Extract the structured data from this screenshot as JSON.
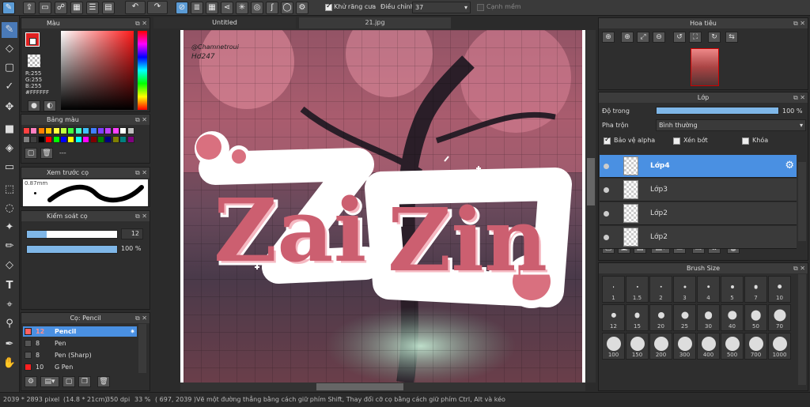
{
  "toolbar": {
    "antialias_label": "Khử răng cưa",
    "adjust_label": "Điều chỉnh",
    "adjust_value": "37",
    "edge_label": "Cạnh mềm"
  },
  "tabs": [
    {
      "label": "Untitled"
    },
    {
      "label": "21.jpg"
    }
  ],
  "color_panel": {
    "title": "Màu",
    "r": "R:255",
    "g": "G:255",
    "b": "B:255",
    "hex": "#FFFFFF",
    "primary": "#e02020",
    "secondary": "#ffffff"
  },
  "palette_panel": {
    "title": "Bảng màu",
    "name": "---",
    "swatches": [
      "#ff4040",
      "#ff80c0",
      "#ff8000",
      "#ffc000",
      "#ffff40",
      "#c0ff40",
      "#40ff40",
      "#40ffc0",
      "#40c0ff",
      "#4080ff",
      "#8040ff",
      "#c040ff",
      "#ff40ff",
      "#ffffff",
      "#c0c0c0",
      "#808080",
      "#404040",
      "#000000",
      "#ff0000",
      "#00ff00",
      "#0000ff",
      "#ffff00",
      "#00ffff",
      "#ff00ff",
      "#800000",
      "#008000",
      "#000080",
      "#808000",
      "#008080",
      "#800080"
    ]
  },
  "preview_panel": {
    "title": "Xem trước cọ",
    "size_label": "0.87mm"
  },
  "brush_control": {
    "title": "Kiểm soát cọ",
    "size_value": "12",
    "opacity_value": "100 %",
    "size_fraction": 0.22,
    "opacity_fraction": 1.0
  },
  "brush_list": {
    "title": "Cọ: Pencil",
    "items": [
      {
        "size": "12",
        "name": "Pencil",
        "color": "#ff6060"
      },
      {
        "size": "8",
        "name": "Pen",
        "color": "#555555"
      },
      {
        "size": "8",
        "name": "Pen (Sharp)",
        "color": "#555555"
      },
      {
        "size": "10",
        "name": "G Pen",
        "color": "#ff2020"
      }
    ]
  },
  "artwork": {
    "watermark_1": "@Chamnetroui",
    "watermark_2": "Hd247",
    "word_1": "Zai",
    "word_2": "Zin"
  },
  "navigator": {
    "title": "Hoa tiêu"
  },
  "layer_panel": {
    "title": "Lớp",
    "opacity_label": "Độ trong",
    "opacity_value": "100 %",
    "opacity_fraction": 1.0,
    "blend_label": "Pha trộn",
    "blend_value": "Bình thường",
    "protect_alpha": "Bảo vệ alpha",
    "clipping": "Xén bớt",
    "lock": "Khóa",
    "layers": [
      {
        "name": "Lớp4"
      },
      {
        "name": "Lớp3"
      },
      {
        "name": "Lớp2"
      },
      {
        "name": "Lớp2"
      }
    ]
  },
  "brush_size": {
    "title": "Brush Size",
    "sizes": [
      "1",
      "1.5",
      "2",
      "3",
      "4",
      "5",
      "7",
      "10",
      "12",
      "15",
      "20",
      "25",
      "30",
      "40",
      "50",
      "70",
      "100",
      "150",
      "200",
      "300",
      "400",
      "500",
      "700",
      "1000"
    ]
  },
  "status": {
    "dimensions": "2039 * 2893 pixel",
    "physical": "(14.8 * 21cm)",
    "dpi": "350 dpi",
    "zoom": "33 %",
    "coords": "( 697, 2039 )",
    "hint": "Vẽ một đường thẳng bằng cách giữ phím Shift, Thay đổi cỡ cọ bằng cách giữ phím Ctrl, Alt và kéo"
  }
}
